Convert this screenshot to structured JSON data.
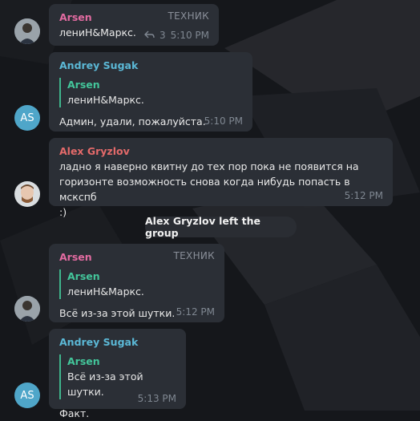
{
  "colors": {
    "arsen": "#e26ba1",
    "andrey": "#5bb8d6",
    "alex": "#e46a6a",
    "quote": "#43c59a"
  },
  "messages": [
    {
      "sender": "Arsen",
      "badge": "ТЕХНИК",
      "text": "лениН&Маркс.",
      "replies": "3",
      "time": "5:10 PM",
      "avatar": "photo"
    },
    {
      "sender": "Andrey Sugak",
      "quote": {
        "sender": "Arsen",
        "text": "лениН&Маркс."
      },
      "text": "Админ, удали, пожалуйста.",
      "time": "5:10 PM",
      "avatar": "AS"
    },
    {
      "sender": "Alex Gryzlov",
      "text": "ладно я наверно квитну до тех пор пока не появится на\nгоризонте возможность снова когда нибудь попасть в мскспб\n:)",
      "time": "5:12 PM",
      "avatar": "photo"
    },
    {
      "sender": "Arsen",
      "badge": "ТЕХНИК",
      "quote": {
        "sender": "Arsen",
        "text": "лениН&Маркс."
      },
      "text": "Всё из-за этой шутки.",
      "time": "5:12 PM",
      "avatar": "photo"
    },
    {
      "sender": "Andrey Sugak",
      "quote": {
        "sender": "Arsen",
        "text": "Всё из-за этой шутки."
      },
      "text": "Факт.",
      "time": "5:13 PM",
      "avatar": "AS"
    }
  ],
  "service_message": "Alex Gryzlov left the group",
  "icons": {
    "reply": "reply-arrow-icon"
  }
}
